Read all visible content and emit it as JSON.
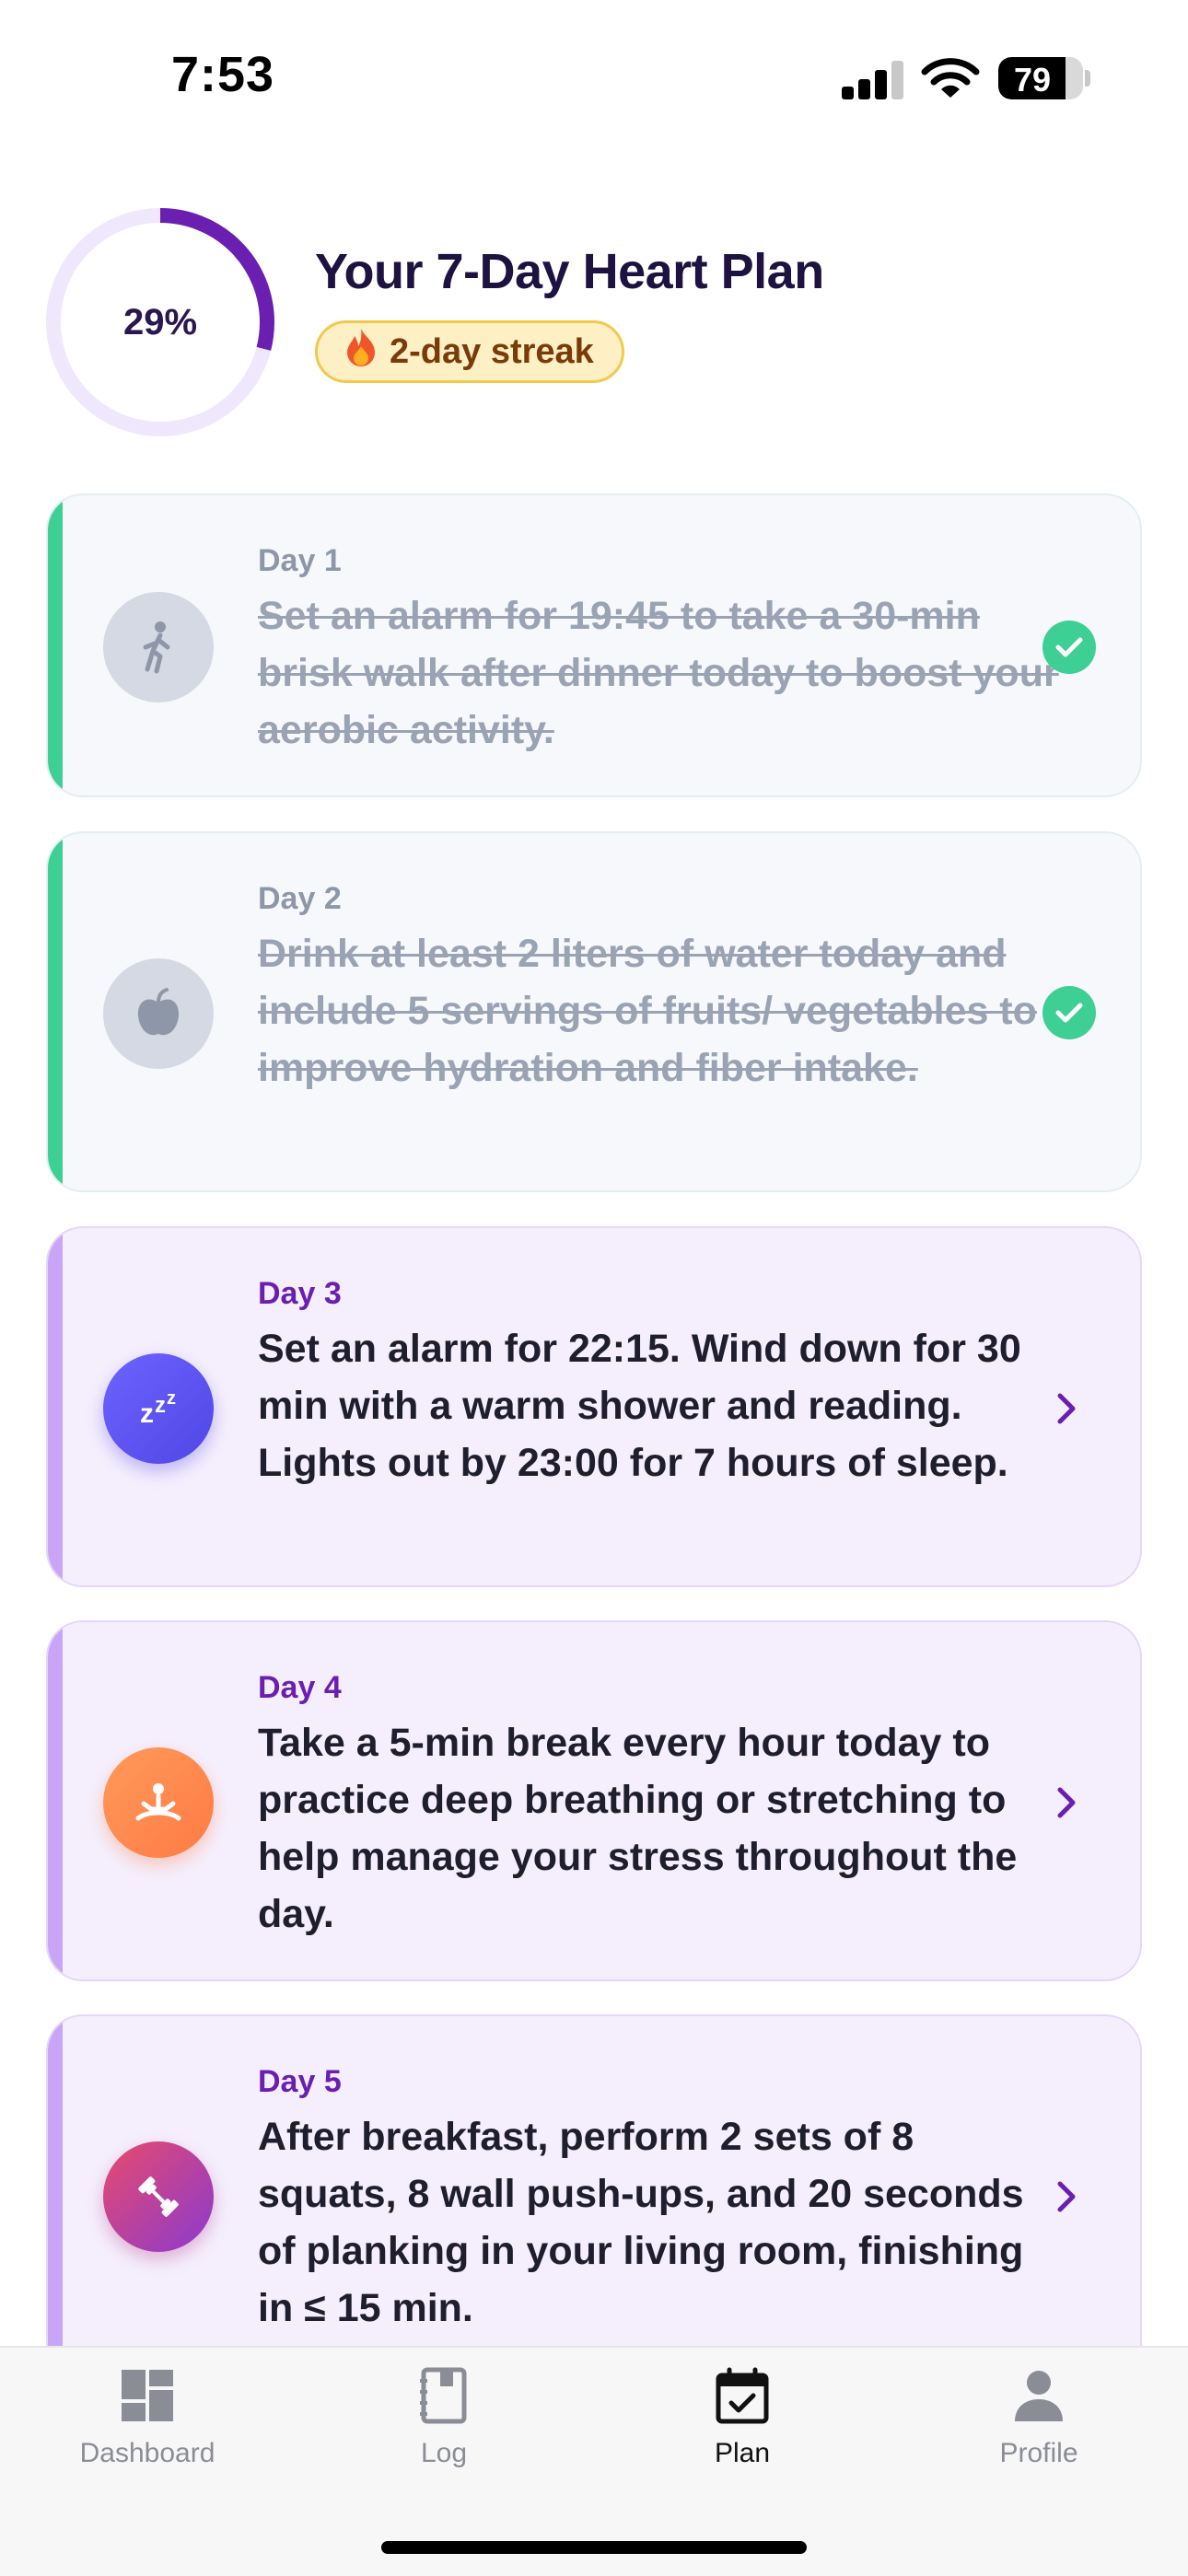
{
  "status_bar": {
    "time": "7:53",
    "battery": "79",
    "battery_level": 0.79
  },
  "header": {
    "progress_label": "29%",
    "progress_value": 0.29,
    "title": "Your 7-Day Heart Plan",
    "streak_icon": "fire-icon",
    "streak_label": "2-day streak"
  },
  "tasks": [
    {
      "day": "Day 1",
      "text": "Set an alarm for 19:45 to take a 30-min brisk walk after dinner today to boost your aerobic activity.",
      "status": "completed",
      "icon": "walking-icon",
      "icon_color": "#94a0b3"
    },
    {
      "day": "Day 2",
      "text": "Drink at least 2 liters of water today and include 5 servings of fruits/ vegetables to improve hydration and fiber intake.",
      "status": "completed",
      "icon": "apple-icon",
      "icon_color": "#94a0b3"
    },
    {
      "day": "Day 3",
      "text": "Set an alarm for 22:15. Wind down for 30 min with a warm shower and reading. Lights out by 23:00 for 7 hours of sleep.",
      "status": "pending",
      "icon": "sleep-icon",
      "icon_color": "#5b5cf0"
    },
    {
      "day": "Day 4",
      "text": "Take a 5-min break every hour today to practice deep breathing or stretching to help manage your stress throughout the day.",
      "status": "pending",
      "icon": "meditation-icon",
      "icon_color": "#ff8a4c"
    },
    {
      "day": "Day 5",
      "text": "After breakfast, perform 2 sets of 8 squats, 8 wall push-ups, and 20 seconds of planking in your living room, finishing in ≤ 15 min.",
      "status": "pending",
      "icon": "dumbbell-icon",
      "icon_color": "#d43f7f"
    }
  ],
  "tab_bar": {
    "tabs": [
      {
        "label": "Dashboard",
        "icon": "dashboard-icon",
        "active": false
      },
      {
        "label": "Log",
        "icon": "notebook-icon",
        "active": false
      },
      {
        "label": "Plan",
        "icon": "calendar-check-icon",
        "active": true
      },
      {
        "label": "Profile",
        "icon": "person-icon",
        "active": false
      }
    ]
  },
  "colors": {
    "accent": "#6a1fb0",
    "completed": "#3ecf95",
    "pending_card": "#f5effd",
    "streak_badge": "#fdf0c4"
  }
}
